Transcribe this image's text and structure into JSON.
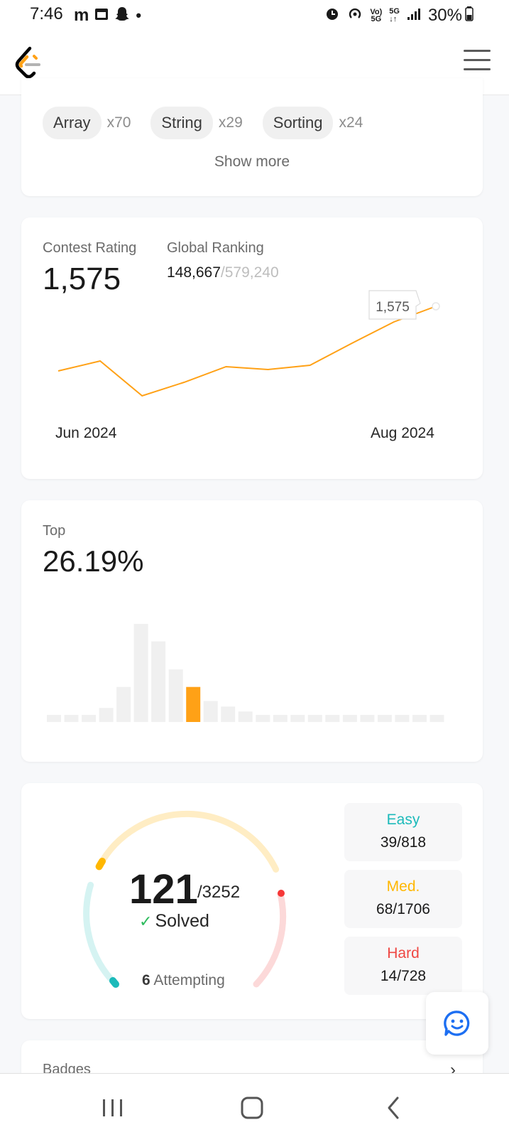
{
  "status_bar": {
    "time": "7:46",
    "left_icons": [
      "gmail-icon",
      "calendar-icon",
      "snapchat-icon",
      "dot-icon"
    ],
    "battery": "30%",
    "right_icons": [
      "alarm-icon",
      "hotspot-icon",
      "volte-icon",
      "5g-icon",
      "signal-icon",
      "battery-icon"
    ]
  },
  "header": {
    "logo": "leetcode-logo",
    "menu_icon": "hamburger-icon"
  },
  "tags": {
    "items": [
      {
        "label": "Array",
        "count": "x70"
      },
      {
        "label": "String",
        "count": "x29"
      },
      {
        "label": "Sorting",
        "count": "x24"
      }
    ],
    "show_more": "Show more"
  },
  "contest": {
    "rating_label": "Contest Rating",
    "rating_value": "1,575",
    "global_label": "Global Ranking",
    "global_rank": "148,667",
    "global_total": "/579,240",
    "tooltip": "1,575"
  },
  "top": {
    "label": "Top",
    "value": "26.19%"
  },
  "solved": {
    "count": "121",
    "total": "/3252",
    "label": "Solved",
    "attempting_count": "6",
    "attempting_label": "Attempting",
    "easy_label": "Easy",
    "easy_value": "39/818",
    "medium_label": "Med.",
    "medium_value": "68/1706",
    "hard_label": "Hard",
    "hard_value": "14/728"
  },
  "badges": {
    "label": "Badges"
  },
  "colors": {
    "accent": "#ffa116",
    "easy": "#1cbaba",
    "medium": "#ffb700",
    "hard": "#f63737",
    "bar_gray": "#f0f0f0"
  },
  "chart_data": [
    {
      "type": "line",
      "title": "",
      "x": [
        "Jun 2024",
        "",
        "",
        "",
        "",
        "",
        "",
        "",
        "",
        "Aug 2024"
      ],
      "series": [
        {
          "values": [
            1484,
            1498,
            1449,
            1468,
            1490,
            1486,
            1492,
            1523,
            1553,
            1575
          ]
        }
      ],
      "x_tick_labels": [
        "Jun 2024",
        "Aug 2024"
      ],
      "ylim": [
        1420,
        1600
      ],
      "grid": false,
      "highlight_label": "1,575"
    },
    {
      "type": "bar",
      "title": "",
      "values": [
        1,
        1,
        1,
        2,
        5,
        14,
        11.5,
        7.5,
        5,
        3,
        2.2,
        1.5,
        1,
        1,
        1,
        1,
        1,
        1,
        1,
        1,
        1,
        1,
        1
      ],
      "highlight_index": 8,
      "ylim": [
        0,
        15
      ],
      "grid": false
    }
  ]
}
